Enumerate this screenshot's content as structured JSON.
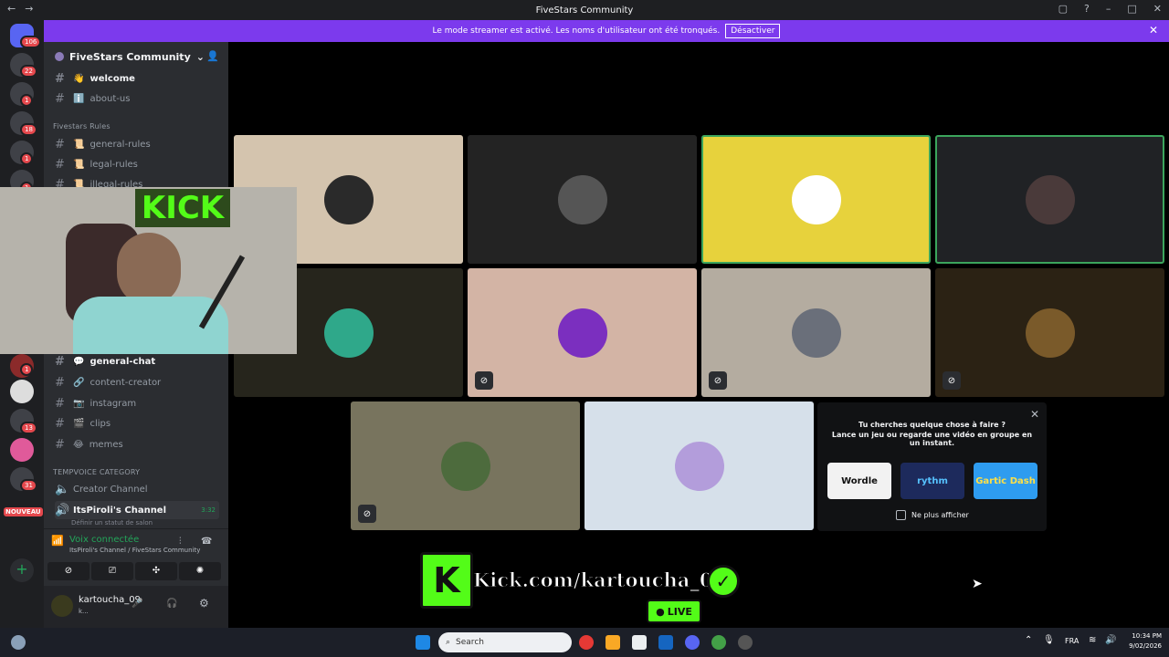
{
  "window": {
    "title": "FiveStars Community"
  },
  "banner": {
    "text": "Le mode streamer est activé. Les noms d'utilisateur ont été tronqués.",
    "button": "Désactiver"
  },
  "guild_badges": [
    "106",
    "22",
    "1",
    "18",
    "1",
    "1",
    "1",
    "13",
    "31"
  ],
  "server": {
    "name": "FiveStars Community"
  },
  "channels_top": [
    {
      "emoji": "👋",
      "name": "welcome",
      "bold": true
    },
    {
      "emoji": "ℹ️",
      "name": "about-us",
      "bold": false
    }
  ],
  "category_rules": "Fivestars Rules",
  "channels_rules": [
    {
      "emoji": "📜",
      "name": "general-rules"
    },
    {
      "emoji": "📜",
      "name": "legal-rules"
    },
    {
      "emoji": "📜",
      "name": "illegal-rules"
    }
  ],
  "channels_chat": [
    {
      "emoji": "💬",
      "name": "general-chat",
      "bold": true
    },
    {
      "emoji": "🔗",
      "name": "content-creator",
      "bold": false
    },
    {
      "emoji": "📷",
      "name": "instagram",
      "bold": false
    },
    {
      "emoji": "🎬",
      "name": "clips",
      "bold": false
    },
    {
      "emoji": "😂",
      "name": "memes",
      "bold": false
    }
  ],
  "category_temp": "TEMPVOICE CATEGORY",
  "voice_channels": [
    {
      "name": "Creator Channel"
    },
    {
      "name": "ItsPiroli's Channel",
      "time": "3:32",
      "status": "Définir un statut de salon"
    }
  ],
  "new_badge": "NOUVEAU",
  "voice": {
    "status": "Voix connectée",
    "detail": "ItsPiroli's Channel / FiveStars Community"
  },
  "user": {
    "name": "kartoucha_09",
    "sub": "k..."
  },
  "webcam": {
    "sign": "KICK"
  },
  "activity": {
    "line1": "Tu cherches quelque chose à faire ?",
    "line2": "Lance un jeu ou regarde une vidéo en groupe en un instant.",
    "games": [
      "Wordle",
      "rythm",
      "Gartic Dash"
    ],
    "checkbox": "Ne plus afficher"
  },
  "overlay": {
    "text": "Kick.com/kartoucha_09",
    "live": "LIVE"
  },
  "taskbar": {
    "search": "Search",
    "lang": "FRA",
    "time": "10:34 PM",
    "date": "9/02/2026"
  },
  "colors": {
    "accent": "#7c3aed",
    "kick": "#53fc18",
    "speaking": "#3ba55c"
  },
  "tiles": [
    {
      "bg": "#d4c4ae",
      "ava": "#2a2a2a",
      "muted": false,
      "selected": false
    },
    {
      "bg": "#232323",
      "ava": "#555555",
      "muted": false,
      "selected": false
    },
    {
      "bg": "#e7d23c",
      "ava": "#ffffff",
      "muted": false,
      "selected": true
    },
    {
      "bg": "#202225",
      "ava": "#4a3a3a",
      "muted": false,
      "selected": true
    },
    {
      "bg": "#26251c",
      "ava": "#2fa88a",
      "muted": false,
      "selected": false
    },
    {
      "bg": "#d3b4a5",
      "ava": "#7b2fbf",
      "muted": true,
      "selected": false
    },
    {
      "bg": "#b4aca0",
      "ava": "#6a6f7a",
      "muted": true,
      "selected": false
    },
    {
      "bg": "#2b2214",
      "ava": "#7a5a2a",
      "muted": true,
      "selected": false
    },
    {
      "bg": "#78745e",
      "ava": "#4d6b3d",
      "muted": true,
      "selected": false
    },
    {
      "bg": "#d6e0ea",
      "ava": "#b39ddb",
      "muted": false,
      "selected": false
    }
  ]
}
